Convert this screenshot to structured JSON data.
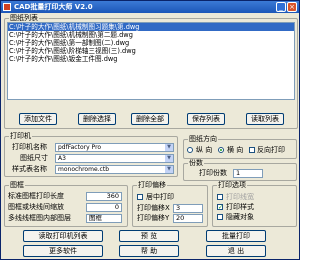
{
  "window": {
    "title": "CAD批量打印大师 V2.0",
    "minimize": "_",
    "close": "×"
  },
  "files": {
    "group_label": "图纸列表",
    "items": [
      "C:\\叶子的大作\\图纸\\机械制图习题集\\第.dwg",
      "C:\\叶子的大作\\图纸\\机械制图\\第二题.dwg",
      "C:\\叶子的大作\\图纸\\第一部制图(二).dwg",
      "C:\\叶子的大作\\图纸\\阶梯轴三视图(三).dwg",
      "C:\\叶子的大作\\图纸\\钣金工件图.dwg"
    ]
  },
  "file_buttons": {
    "add": "添加文件",
    "remove": "删除选择",
    "clear": "删除全部",
    "save": "保存列表",
    "load": "读取列表"
  },
  "printer": {
    "group_label": "打印机",
    "name_label": "打印机名称",
    "name_value": "pdfFactory Pro",
    "size_label": "图纸尺寸",
    "size_value": "A3",
    "style_label": "样式表名称",
    "style_value": "monochrome.ctb"
  },
  "orientation": {
    "group_label": "图纸方向",
    "landscape": "纵 向",
    "portrait": "横 向",
    "reverse": "反向打印"
  },
  "copies": {
    "group_label": "份数",
    "label": "打印份数",
    "value": "1"
  },
  "frame": {
    "group_label": "图框",
    "width_label": "标准图框打印长度",
    "width_value": "360",
    "offset_label": "图框或块线间缩放",
    "offset_value": "0",
    "type_label": "多线线框图内部图层",
    "type_value": "图框"
  },
  "offset": {
    "group_label": "打印偏移",
    "center_label": "居中打印",
    "x_label": "打印偏移X",
    "x_value": "3",
    "y_label": "打印偏移Y",
    "y_value": "20"
  },
  "options": {
    "group_label": "打印选项",
    "linewidth": "打印线宽",
    "hidden": "打印样式",
    "scale": "隐藏对象"
  },
  "bottom_buttons": {
    "read_print": "读取打印机列表",
    "preview": "预 览",
    "batch": "批量打印",
    "more": "更多软件",
    "help": "帮 助",
    "exit": "退 出"
  }
}
